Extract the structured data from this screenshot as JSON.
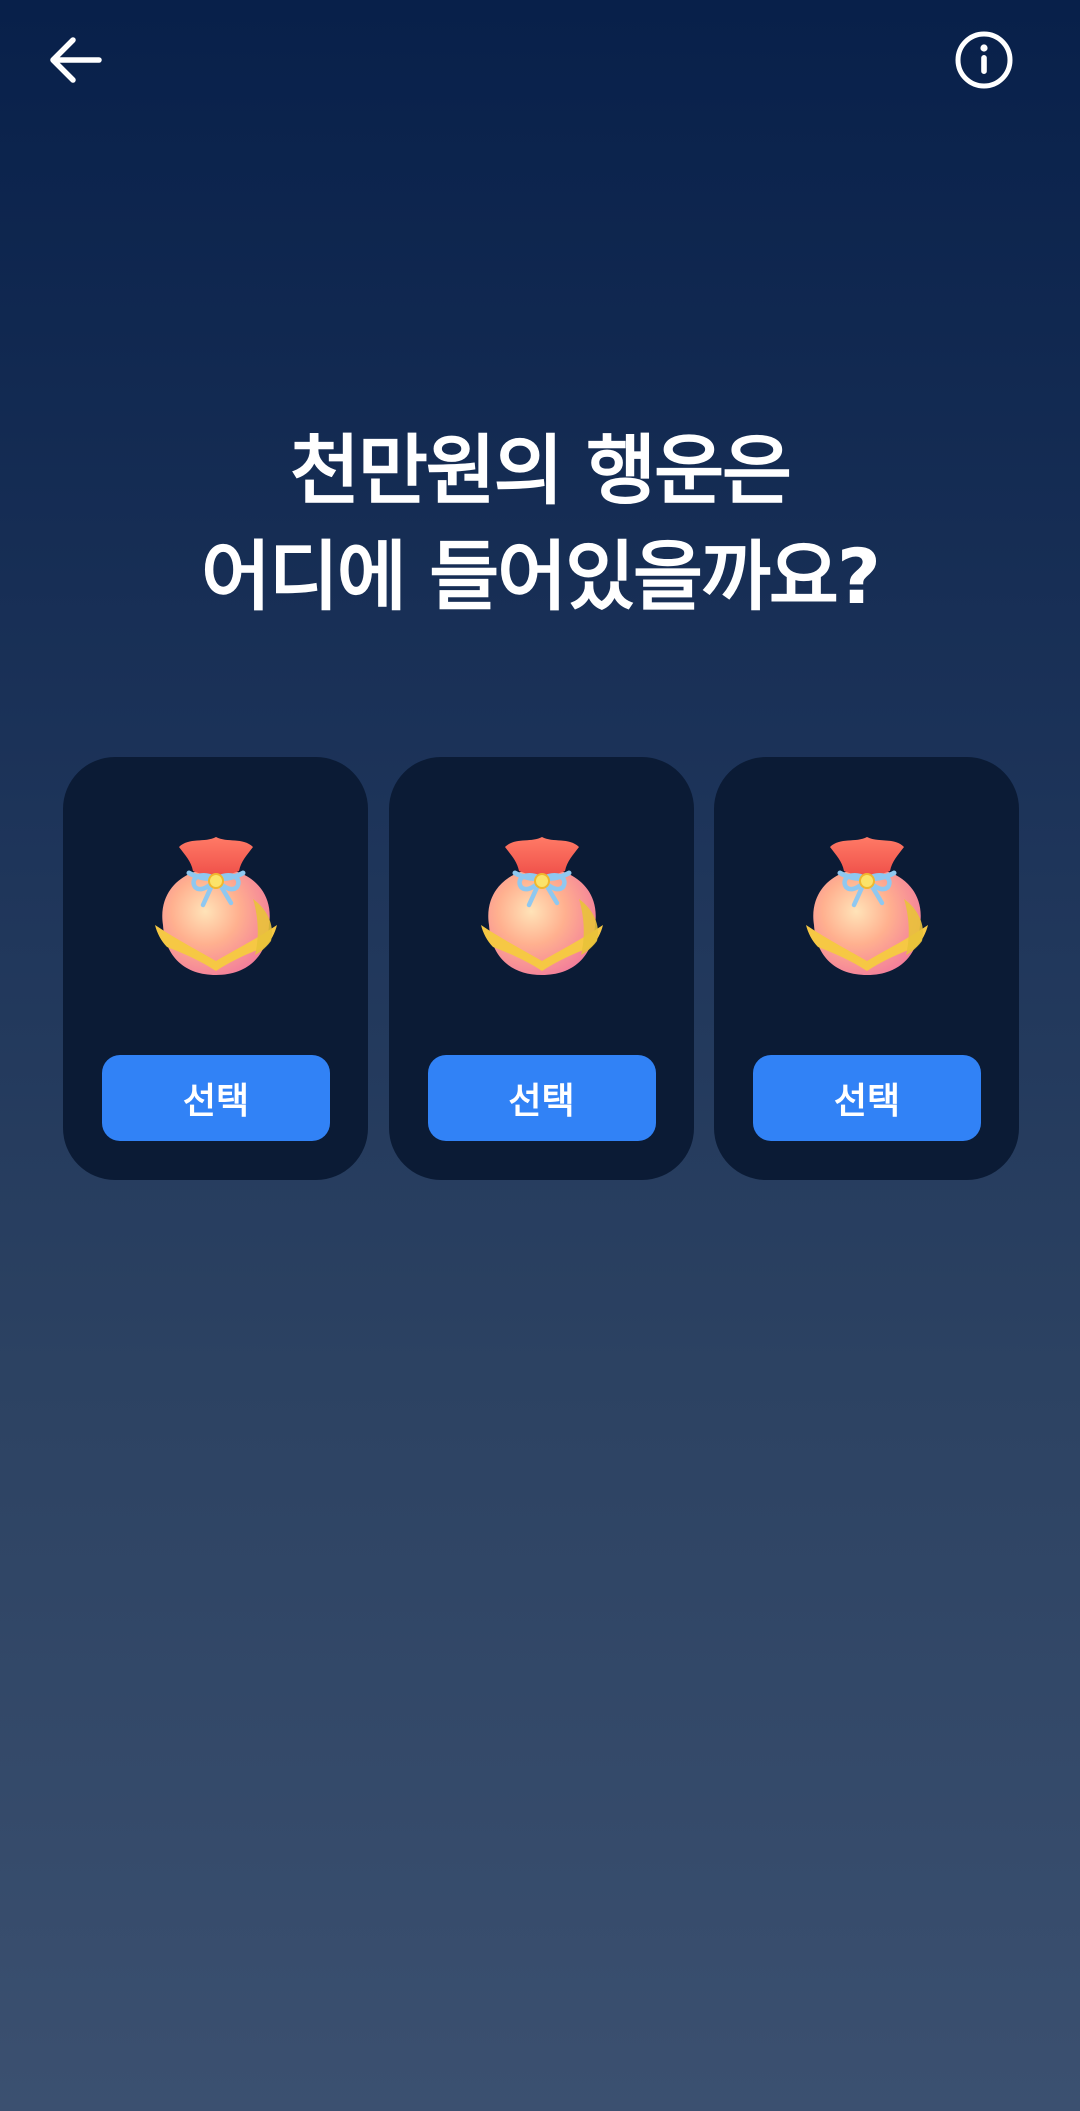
{
  "header": {
    "back_icon": "arrow-left-icon",
    "info_icon": "info-circle-icon"
  },
  "headline": {
    "line1": "천만원의 행운은",
    "line2": "어디에 들어있을까요?"
  },
  "cards": [
    {
      "icon": "lucky-pouch-icon",
      "button_label": "선택"
    },
    {
      "icon": "lucky-pouch-icon",
      "button_label": "선택"
    },
    {
      "icon": "lucky-pouch-icon",
      "button_label": "선택"
    }
  ],
  "colors": {
    "background_top": "#08204a",
    "background_bottom": "#3b5070",
    "card": "#0b1b35",
    "button": "#3182f6",
    "text": "#ffffff"
  }
}
